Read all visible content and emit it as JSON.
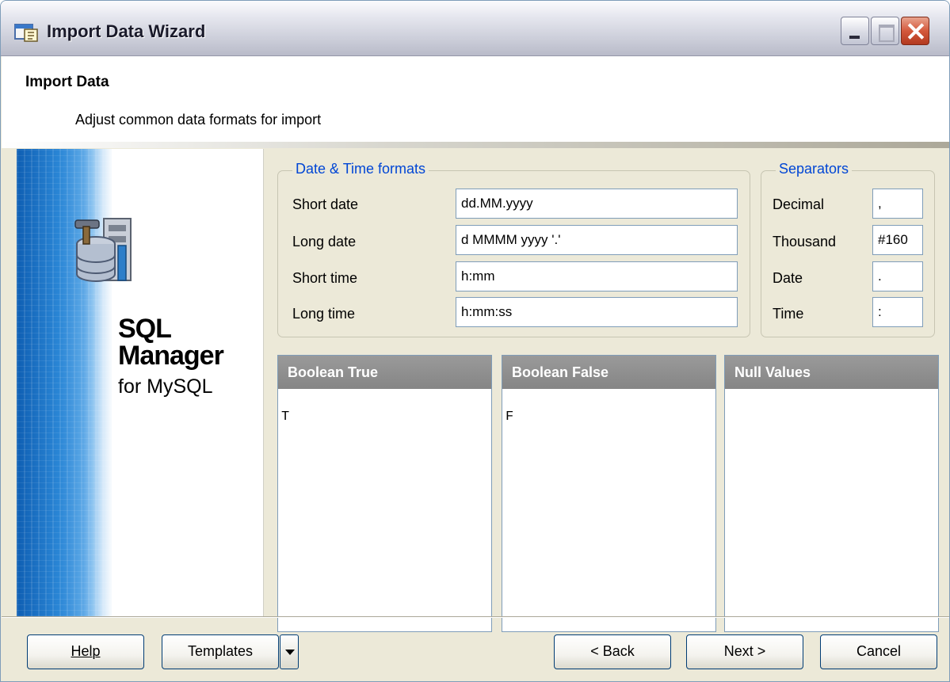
{
  "window": {
    "title": "Import Data Wizard"
  },
  "header": {
    "title": "Import Data",
    "subtitle": "Adjust common data formats for import"
  },
  "banner": {
    "line1": "SQL",
    "line2": "Manager",
    "line3": "for MySQL"
  },
  "date_time": {
    "legend": "Date & Time formats",
    "rows": [
      {
        "label": "Short date",
        "value": "dd.MM.yyyy"
      },
      {
        "label": "Long date",
        "value": "d MMMM yyyy '.'"
      },
      {
        "label": "Short time",
        "value": "h:mm"
      },
      {
        "label": "Long time",
        "value": "h:mm:ss"
      }
    ]
  },
  "separators": {
    "legend": "Separators",
    "rows": [
      {
        "label": "Decimal",
        "value": ","
      },
      {
        "label": "Thousand",
        "value": "#160"
      },
      {
        "label": "Date",
        "value": "."
      },
      {
        "label": "Time",
        "value": ":"
      }
    ]
  },
  "lists": [
    {
      "header": "Boolean True",
      "value": "T"
    },
    {
      "header": "Boolean False",
      "value": "F"
    },
    {
      "header": "Null Values",
      "value": ""
    }
  ],
  "buttons": {
    "help": "Help",
    "templates": "Templates",
    "back": "< Back",
    "next": "Next >",
    "cancel": "Cancel"
  },
  "colors": {
    "legend": "#0046d5",
    "list_header": "#8f8f8f",
    "dialog_bg": "#ece9d8"
  }
}
